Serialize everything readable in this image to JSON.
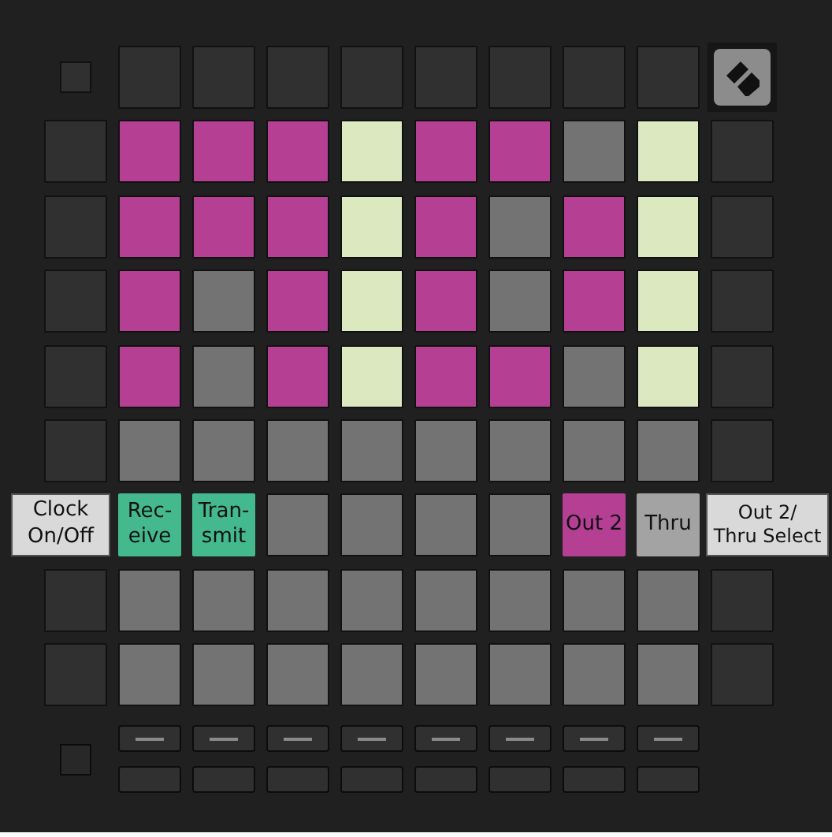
{
  "top_row": {
    "pads": [
      {
        "color": "#303030"
      },
      {
        "color": "#303030"
      },
      {
        "color": "#303030"
      },
      {
        "color": "#303030"
      },
      {
        "color": "#303030"
      },
      {
        "color": "#303030"
      },
      {
        "color": "#303030"
      },
      {
        "color": "#303030"
      }
    ]
  },
  "rows": [
    {
      "left": {
        "kind": "pad"
      },
      "right": {
        "kind": "pad"
      },
      "pads": [
        {
          "color": "#b43f93"
        },
        {
          "color": "#b43f93"
        },
        {
          "color": "#b43f93"
        },
        {
          "color": "#dce8c0"
        },
        {
          "color": "#b43f93"
        },
        {
          "color": "#b43f93"
        },
        {
          "color": "#737373"
        },
        {
          "color": "#dce8c0"
        }
      ]
    },
    {
      "left": {
        "kind": "pad"
      },
      "right": {
        "kind": "pad"
      },
      "pads": [
        {
          "color": "#b43f93"
        },
        {
          "color": "#b43f93"
        },
        {
          "color": "#b43f93"
        },
        {
          "color": "#dce8c0"
        },
        {
          "color": "#b43f93"
        },
        {
          "color": "#737373"
        },
        {
          "color": "#b43f93"
        },
        {
          "color": "#dce8c0"
        }
      ]
    },
    {
      "left": {
        "kind": "pad"
      },
      "right": {
        "kind": "pad"
      },
      "pads": [
        {
          "color": "#b43f93"
        },
        {
          "color": "#737373"
        },
        {
          "color": "#b43f93"
        },
        {
          "color": "#dce8c0"
        },
        {
          "color": "#b43f93"
        },
        {
          "color": "#737373"
        },
        {
          "color": "#b43f93"
        },
        {
          "color": "#dce8c0"
        }
      ]
    },
    {
      "left": {
        "kind": "pad"
      },
      "right": {
        "kind": "pad"
      },
      "pads": [
        {
          "color": "#b43f93"
        },
        {
          "color": "#737373"
        },
        {
          "color": "#b43f93"
        },
        {
          "color": "#dce8c0"
        },
        {
          "color": "#b43f93"
        },
        {
          "color": "#b43f93"
        },
        {
          "color": "#737373"
        },
        {
          "color": "#dce8c0"
        }
      ]
    },
    {
      "left": {
        "kind": "pad"
      },
      "right": {
        "kind": "pad"
      },
      "pads": [
        {
          "color": "#737373"
        },
        {
          "color": "#737373"
        },
        {
          "color": "#737373"
        },
        {
          "color": "#737373"
        },
        {
          "color": "#737373"
        },
        {
          "color": "#737373"
        },
        {
          "color": "#737373"
        },
        {
          "color": "#737373"
        }
      ]
    },
    {
      "left": {
        "kind": "label",
        "text": "Clock\nOn/Off"
      },
      "right": {
        "kind": "label",
        "text": "Out 2/\nThru Select"
      },
      "pads": [
        {
          "color": "#45b98e",
          "label": "Rec-\neive"
        },
        {
          "color": "#45b98e",
          "label": "Tran-\nsmit"
        },
        {
          "color": "#737373"
        },
        {
          "color": "#737373"
        },
        {
          "color": "#737373"
        },
        {
          "color": "#737373"
        },
        {
          "color": "#b43f93",
          "label": "Out 2"
        },
        {
          "color": "#a3a3a3",
          "label": "Thru"
        }
      ]
    },
    {
      "left": {
        "kind": "pad"
      },
      "right": {
        "kind": "pad"
      },
      "pads": [
        {
          "color": "#737373"
        },
        {
          "color": "#737373"
        },
        {
          "color": "#737373"
        },
        {
          "color": "#737373"
        },
        {
          "color": "#737373"
        },
        {
          "color": "#737373"
        },
        {
          "color": "#737373"
        },
        {
          "color": "#737373"
        }
      ]
    },
    {
      "left": {
        "kind": "pad"
      },
      "right": {
        "kind": "pad"
      },
      "pads": [
        {
          "color": "#737373"
        },
        {
          "color": "#737373"
        },
        {
          "color": "#737373"
        },
        {
          "color": "#737373"
        },
        {
          "color": "#737373"
        },
        {
          "color": "#737373"
        },
        {
          "color": "#737373"
        },
        {
          "color": "#737373"
        }
      ]
    }
  ],
  "bottom_rows": [
    {
      "buttons": [
        {
          "kind": "dash"
        },
        {
          "kind": "dash"
        },
        {
          "kind": "dash"
        },
        {
          "kind": "dash"
        },
        {
          "kind": "dash"
        },
        {
          "kind": "dash"
        },
        {
          "kind": "dash"
        },
        {
          "kind": "dash"
        }
      ]
    },
    {
      "buttons": [
        {
          "kind": "plain"
        },
        {
          "kind": "plain"
        },
        {
          "kind": "plain"
        },
        {
          "kind": "plain"
        },
        {
          "kind": "plain"
        },
        {
          "kind": "plain"
        },
        {
          "kind": "plain"
        },
        {
          "kind": "plain"
        }
      ]
    }
  ]
}
